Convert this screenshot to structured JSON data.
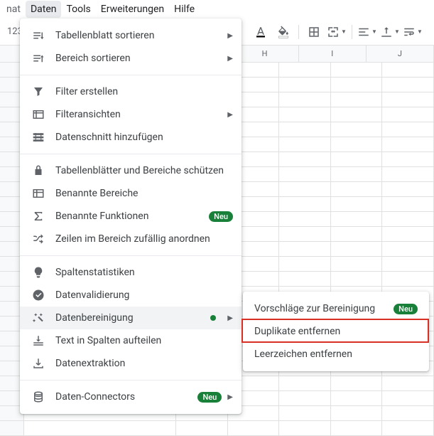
{
  "menubar": {
    "cut": "nat",
    "items": [
      "Daten",
      "Tools",
      "Erweiterungen",
      "Hilfe"
    ],
    "active_index": 0
  },
  "toolbar": {
    "num_format": "123"
  },
  "sheet": {
    "columns": [
      "H",
      "I",
      "J"
    ]
  },
  "menu": {
    "items": [
      {
        "icon": "sort-sheet",
        "label": "Tabellenblatt sortieren",
        "arrow": true
      },
      {
        "icon": "sort-range",
        "label": "Bereich sortieren",
        "arrow": true
      },
      {
        "sep": true
      },
      {
        "icon": "funnel",
        "label": "Filter erstellen"
      },
      {
        "icon": "filter-views",
        "label": "Filteransichten",
        "arrow": true
      },
      {
        "icon": "slicer",
        "label": "Datenschnitt hinzufügen"
      },
      {
        "sep": true
      },
      {
        "icon": "lock",
        "label": "Tabellenblätter und Bereiche schützen"
      },
      {
        "icon": "named-range",
        "label": "Benannte Bereiche"
      },
      {
        "icon": "sigma",
        "label": "Benannte Funktionen",
        "badge": "Neu"
      },
      {
        "icon": "shuffle",
        "label": "Zeilen im Bereich zufällig anordnen"
      },
      {
        "sep": true
      },
      {
        "icon": "bulb",
        "label": "Spaltenstatistiken"
      },
      {
        "icon": "check-circle",
        "label": "Datenvalidierung"
      },
      {
        "icon": "wand",
        "label": "Datenbereinigung",
        "dot": true,
        "arrow": true,
        "hovered": true
      },
      {
        "icon": "split",
        "label": "Text in Spalten aufteilen"
      },
      {
        "icon": "extract",
        "label": "Datenextraktion"
      },
      {
        "sep": true
      },
      {
        "icon": "database",
        "label": "Daten-Connectors",
        "badge": "Neu",
        "arrow": true
      }
    ]
  },
  "submenu": {
    "items": [
      {
        "label": "Vorschläge zur Bereinigung",
        "badge": "Neu"
      },
      {
        "label": "Duplikate entfernen",
        "highlight": true
      },
      {
        "label": "Leerzeichen entfernen"
      }
    ]
  }
}
